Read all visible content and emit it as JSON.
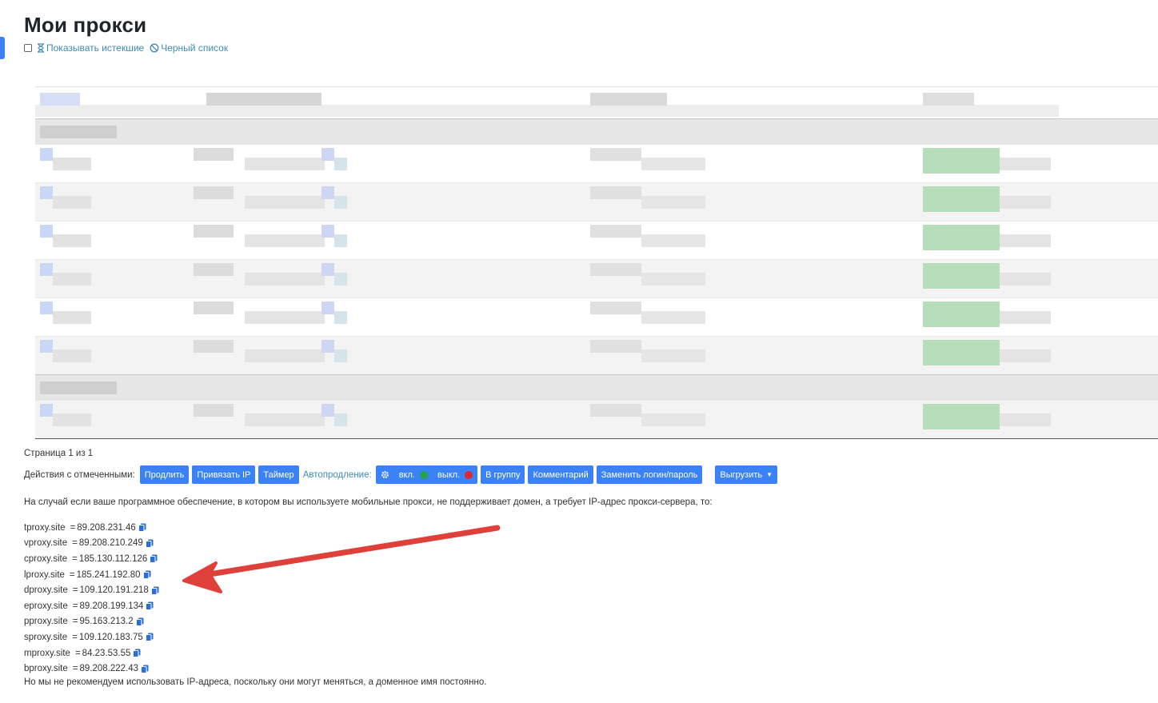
{
  "page": {
    "title": "Мои прокси",
    "filters": {
      "show_expired": "Показывать истекшие",
      "blacklist": "Черный список"
    }
  },
  "pagination": {
    "text": "Страница 1 из 1"
  },
  "actions": {
    "label": "Действия с отмеченными:",
    "extend": "Продлить",
    "bind_ip": "Привязать IP",
    "timer": "Таймер",
    "autorenew_label": "Автопродление:",
    "autorenew_on": "вкл.",
    "autorenew_off": "выкл.",
    "to_group": "В группу",
    "comment": "Комментарий",
    "replace_login": "Заменить логин/пароль",
    "export": "Выгрузить"
  },
  "colors": {
    "accent": "#3b82f6",
    "link": "#3d8bb5",
    "on_dot": "#22a447",
    "off_dot": "#e0262f",
    "arrow": "#e0403a"
  },
  "info": {
    "notice": "На случай если ваше программное обеспечение, в котором вы используете мобильные прокси, не поддерживает домен, а требует IP-адрес прокси-сервера, то:",
    "proxies": [
      {
        "host": "tproxy.site",
        "ip": "89.208.231.46"
      },
      {
        "host": "vproxy.site",
        "ip": "89.208.210.249"
      },
      {
        "host": "cproxy.site",
        "ip": "185.130.112.126"
      },
      {
        "host": "lproxy.site",
        "ip": "185.241.192.80"
      },
      {
        "host": "dproxy.site",
        "ip": "109.120.191.218"
      },
      {
        "host": "eproxy.site",
        "ip": "89.208.199.134"
      },
      {
        "host": "pproxy.site",
        "ip": "95.163.213.2"
      },
      {
        "host": "sproxy.site",
        "ip": "109.120.183.75"
      },
      {
        "host": "mproxy.site",
        "ip": "84.23.53.55"
      },
      {
        "host": "bproxy.site",
        "ip": "89.208.222.43"
      }
    ],
    "footer": "Но мы не рекомендуем использовать IP-адреса, поскольку они могут меняться, а доменное имя постоянно."
  }
}
